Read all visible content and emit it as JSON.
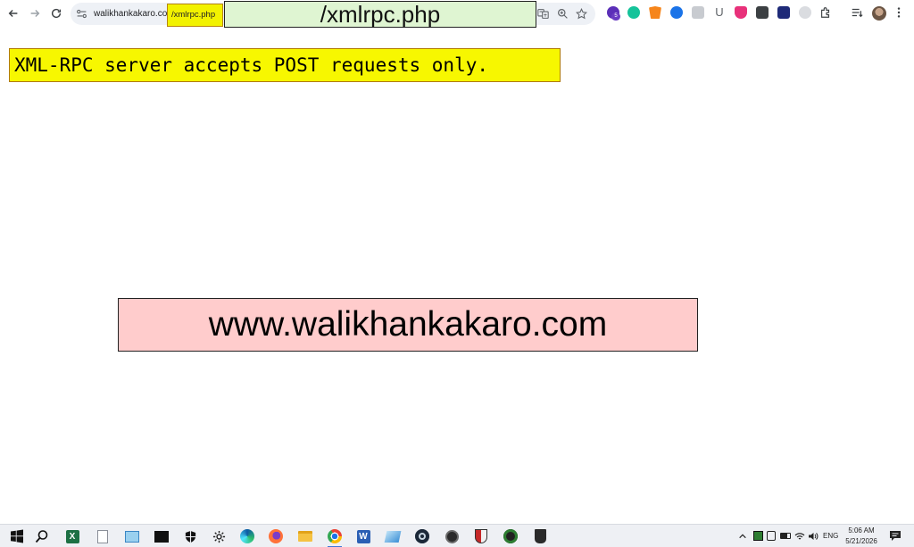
{
  "browser": {
    "url_host": "walikhankakaro.com",
    "url_path": "/xmlrpc.php",
    "extension_badge": "5"
  },
  "annotations": {
    "top_banner": "/xmlrpc.php",
    "site_banner": "www.walikhankakaro.com"
  },
  "page": {
    "message": "XML-RPC server accepts POST requests only."
  },
  "taskbar": {
    "language": "ENG",
    "time": "5:06 AM",
    "date": "5/21/2026"
  }
}
